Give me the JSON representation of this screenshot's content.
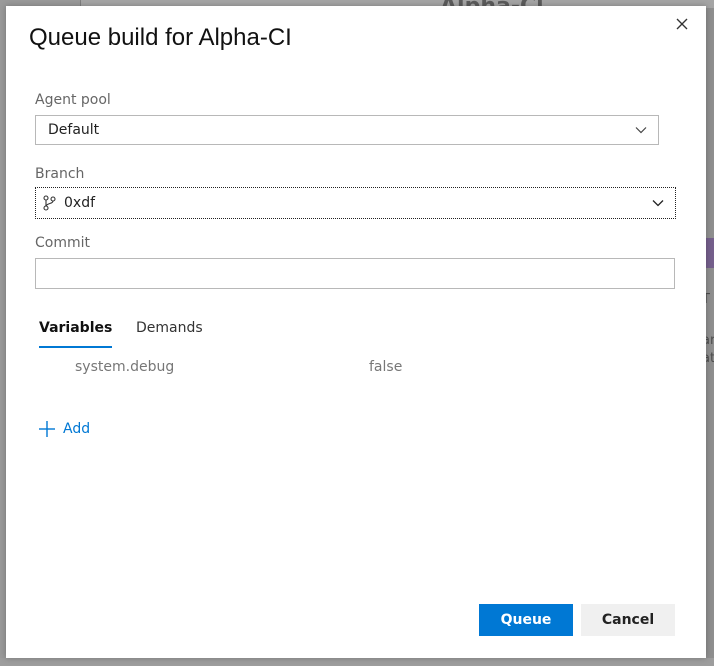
{
  "dialog": {
    "title": "Queue build for Alpha-CI"
  },
  "agent_pool": {
    "label": "Agent pool",
    "value": "Default"
  },
  "branch": {
    "label": "Branch",
    "value": "0xdf"
  },
  "commit": {
    "label": "Commit",
    "value": ""
  },
  "tabs": [
    {
      "label": "Variables",
      "active": true
    },
    {
      "label": "Demands",
      "active": false
    }
  ],
  "variables": [
    {
      "name": "system.debug",
      "value": "false"
    }
  ],
  "add_label": "Add",
  "buttons": {
    "queue": "Queue",
    "cancel": "Cancel"
  },
  "background": {
    "header_fragment": "Alpha-Cl",
    "side_fragments": [
      "T",
      "ar",
      "at"
    ]
  },
  "colors": {
    "accent": "#0078d4",
    "secondary_button": "#f0f0f0"
  }
}
